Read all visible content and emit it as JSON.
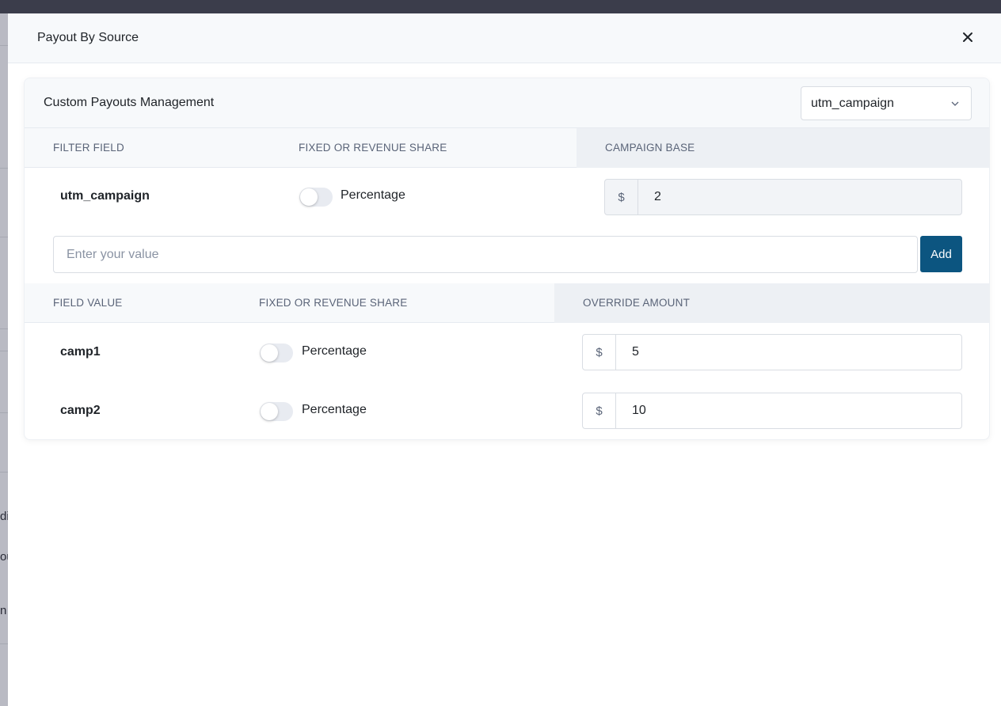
{
  "modal": {
    "title": "Payout By Source",
    "close_icon": "close-icon"
  },
  "background_fragments": [
    "di",
    "ou",
    "n"
  ],
  "card": {
    "title": "Custom Payouts Management",
    "source_select": {
      "value": "utm_campaign"
    }
  },
  "base_table": {
    "headers": [
      "FILTER FIELD",
      "FIXED OR REVENUE SHARE",
      "CAMPAIGN BASE"
    ],
    "row": {
      "field": "utm_campaign",
      "toggle_label": "Percentage",
      "toggle_on": false,
      "currency": "$",
      "amount": "2"
    }
  },
  "add_value": {
    "placeholder": "Enter your value",
    "button_label": "Add"
  },
  "override_table": {
    "headers": [
      "FIELD VALUE",
      "FIXED OR REVENUE SHARE",
      "OVERRIDE AMOUNT"
    ],
    "rows": [
      {
        "field": "camp1",
        "toggle_label": "Percentage",
        "toggle_on": false,
        "currency": "$",
        "amount": "5"
      },
      {
        "field": "camp2",
        "toggle_label": "Percentage",
        "toggle_on": false,
        "currency": "$",
        "amount": "10"
      }
    ]
  },
  "colors": {
    "primary_button": "#0c5580",
    "topbar": "#3b3d4b"
  }
}
